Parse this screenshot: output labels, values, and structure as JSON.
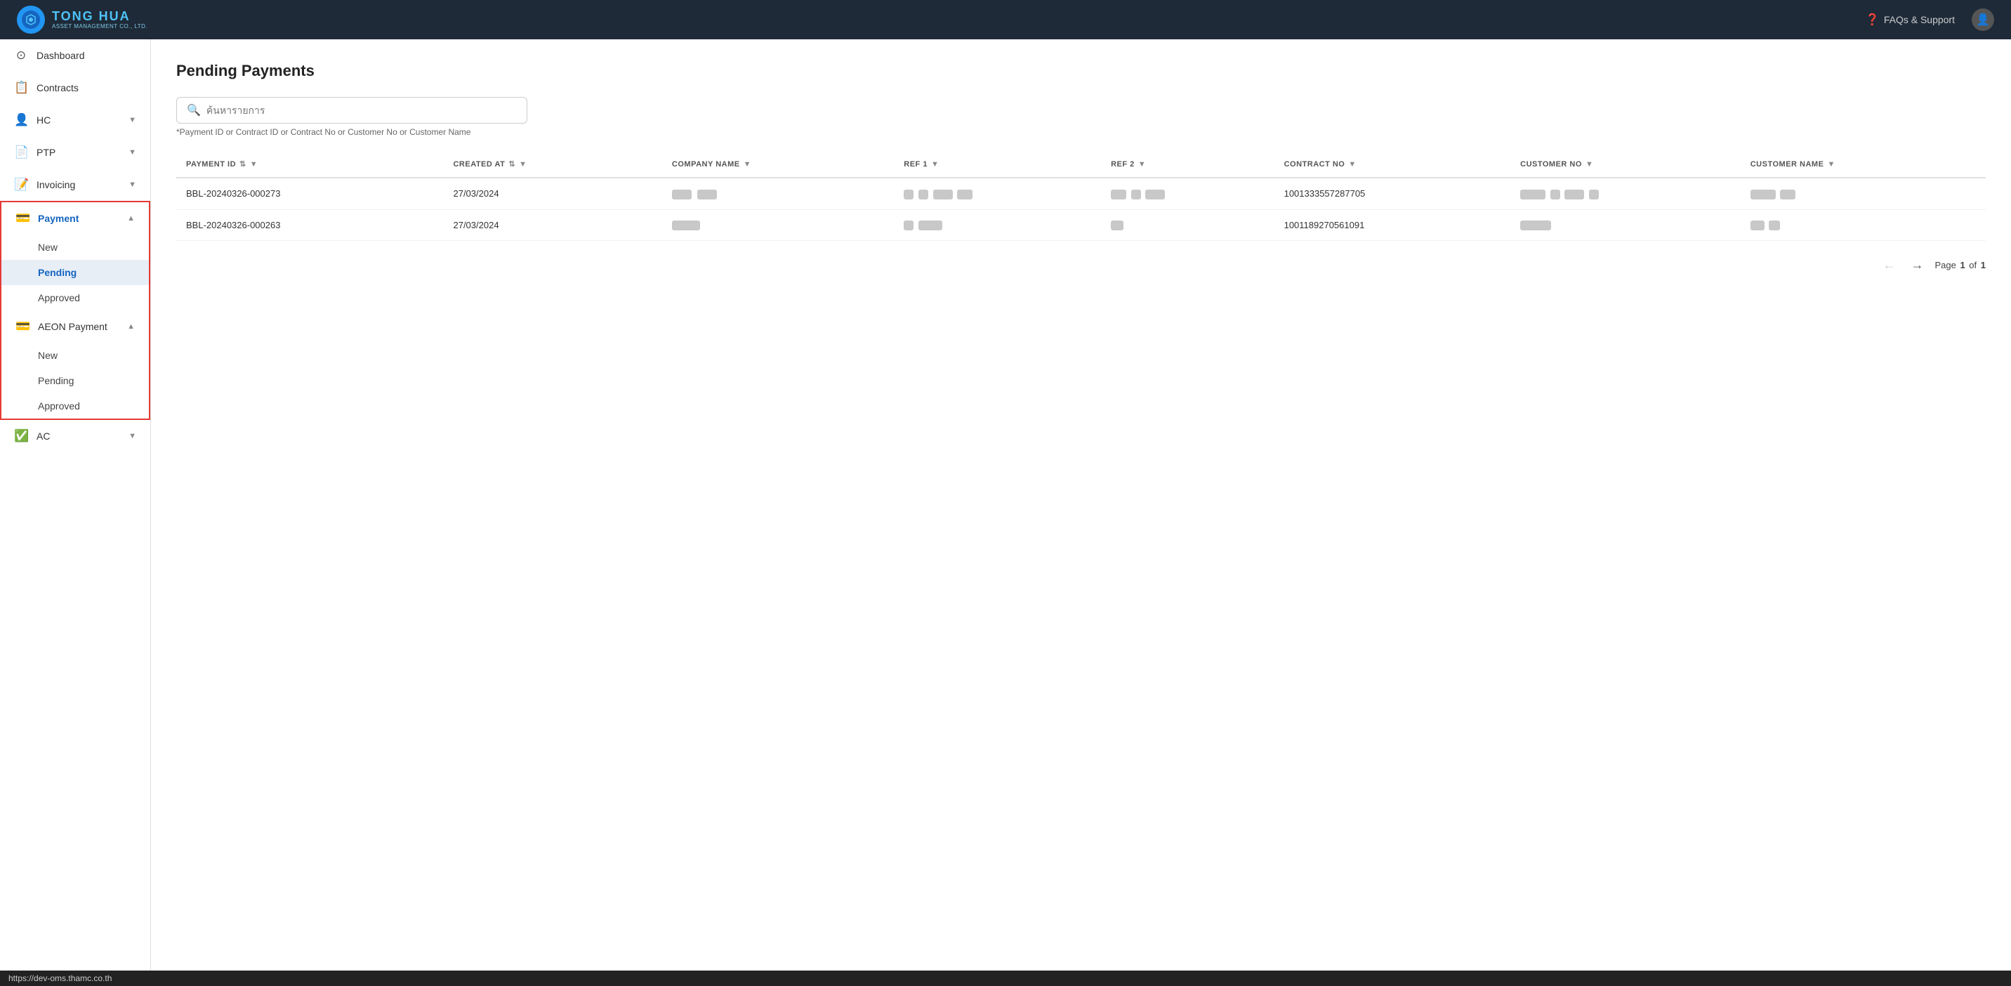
{
  "topnav": {
    "logo_line1": "TONG HUA",
    "logo_line2": "ASSET MANAGEMENT CO., LTD.",
    "support_label": "FAQs & Support",
    "user_icon": "👤"
  },
  "sidebar": {
    "items": [
      {
        "id": "dashboard",
        "label": "Dashboard",
        "icon": "⊙",
        "type": "item"
      },
      {
        "id": "contracts",
        "label": "Contracts",
        "icon": "📋",
        "type": "item"
      },
      {
        "id": "hc",
        "label": "HC",
        "icon": "👤",
        "type": "expandable",
        "expanded": false
      },
      {
        "id": "ptp",
        "label": "PTP",
        "icon": "📄",
        "type": "expandable",
        "expanded": false
      },
      {
        "id": "invoicing",
        "label": "Invoicing",
        "icon": "📝",
        "type": "expandable",
        "expanded": false
      },
      {
        "id": "payment",
        "label": "Payment",
        "icon": "💳",
        "type": "expandable",
        "expanded": true,
        "children": [
          "New",
          "Pending",
          "Approved"
        ]
      },
      {
        "id": "aeon-payment",
        "label": "AEON Payment",
        "icon": "💳",
        "type": "expandable",
        "expanded": true,
        "children": [
          "New",
          "Pending",
          "Approved"
        ]
      },
      {
        "id": "ac",
        "label": "AC",
        "icon": "✅",
        "type": "expandable",
        "expanded": false
      }
    ]
  },
  "main": {
    "page_title": "Pending Payments",
    "search_placeholder": "ค้นหารายการ",
    "search_hint": "*Payment ID or Contract ID or Contract No or Customer No or Customer Name",
    "table": {
      "columns": [
        {
          "id": "payment_id",
          "label": "PAYMENT ID",
          "sortable": true,
          "filterable": true
        },
        {
          "id": "created_at",
          "label": "CREATED AT",
          "sortable": true,
          "filterable": true
        },
        {
          "id": "company_name",
          "label": "COMPANY NAME",
          "sortable": false,
          "filterable": true
        },
        {
          "id": "ref1",
          "label": "REF 1",
          "sortable": false,
          "filterable": true
        },
        {
          "id": "ref2",
          "label": "REF 2",
          "sortable": false,
          "filterable": true
        },
        {
          "id": "contract_no",
          "label": "CONTRACT NO",
          "sortable": false,
          "filterable": true
        },
        {
          "id": "customer_no",
          "label": "CUSTOMER NO",
          "sortable": false,
          "filterable": true
        },
        {
          "id": "customer_name",
          "label": "CUSTOMER NAME",
          "sortable": false,
          "filterable": true
        }
      ],
      "rows": [
        {
          "payment_id": "BBL-20240326-000273",
          "created_at": "27/03/2024",
          "company_name": "redacted",
          "ref1": "redacted",
          "ref2": "redacted",
          "contract_no": "1001333557287705",
          "customer_no": "redacted",
          "customer_name": "redacted"
        },
        {
          "payment_id": "BBL-20240326-000263",
          "created_at": "27/03/2024",
          "company_name": "redacted",
          "ref1": "redacted",
          "ref2": "redacted",
          "contract_no": "1001189270561091",
          "customer_no": "redacted",
          "customer_name": "redacted"
        }
      ]
    },
    "pagination": {
      "current_page": 1,
      "total_pages": 1,
      "label": "Page",
      "of_label": "of"
    }
  },
  "url_bar": {
    "url": "https://dev-oms.thamc.co.th"
  }
}
